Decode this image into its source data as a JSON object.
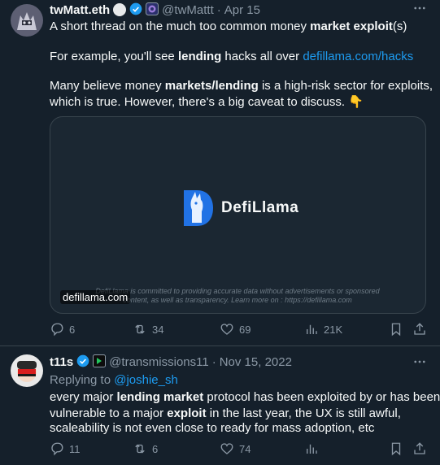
{
  "tweet1": {
    "display_name": "twMatt.eth",
    "handle": "@twMattt",
    "separator": "·",
    "date": "Apr 15",
    "line1_pre": "A short thread on the much too common money ",
    "line1_bold1": "market exploit",
    "line1_post": "(s)",
    "line2_pre": "For example, you'll see ",
    "line2_bold": "lending",
    "line2_mid": " hacks all over ",
    "line2_link": "defillama.com/hacks",
    "line3_pre": "Many believe money ",
    "line3_bold": "markets/lending",
    "line3_post": " is a high-risk sector for exploits,",
    "line4": "which is true. However, there's a big caveat to discuss. 👇",
    "card": {
      "brand": "DefiLlama",
      "caption_line1": "DefiLlama is committed to providing accurate data without advertisements or sponsored",
      "caption_line2": "content, as well as transparency. Learn more on : https://defillama.com",
      "domain": "defillama.com"
    },
    "actions": {
      "replies": "6",
      "retweets": "34",
      "likes": "69",
      "views": "21K"
    }
  },
  "tweet2": {
    "display_name": "t11s",
    "handle": "@transmissions11",
    "separator": "·",
    "date": "Nov 15, 2022",
    "replying_to_label": "Replying to ",
    "replying_to_handle": "@joshie_sh",
    "l1_pre": "every major ",
    "l1_bold": "lending market",
    "l1_post": " protocol has been exploited by or has been",
    "l2_pre": "vulnerable to a major ",
    "l2_bold": "exploit",
    "l2_post": " in the last year, the UX is still awful,",
    "l3": "scaleability is not even close to ready for mass adoption, etc",
    "actions": {
      "replies": "11",
      "retweets": "6",
      "likes": "74"
    }
  },
  "icons": {
    "more": "more-icon",
    "verified": "verified-icon",
    "reply": "reply-icon",
    "retweet": "retweet-icon",
    "like": "like-icon",
    "views": "views-icon",
    "bookmark": "bookmark-icon",
    "share": "share-icon"
  },
  "colors": {
    "background": "#15202b",
    "link": "#1d9bf0",
    "muted": "#8b98a5",
    "border": "#38444d"
  }
}
